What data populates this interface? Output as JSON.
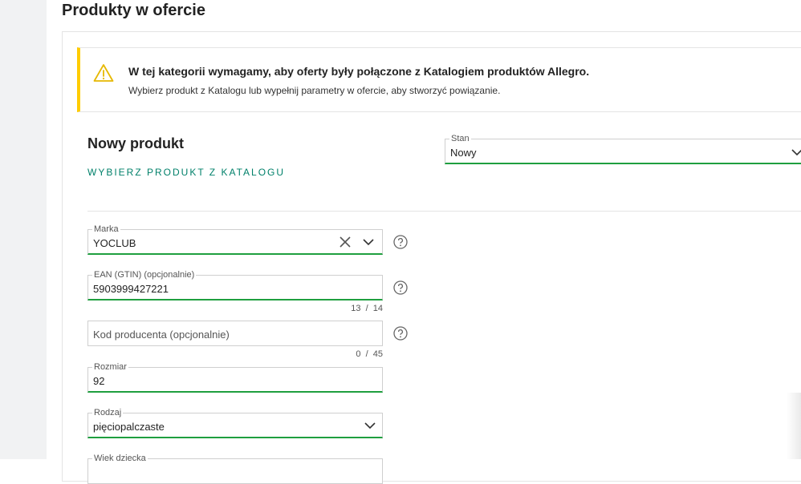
{
  "page": {
    "title": "Produkty w ofercie"
  },
  "alert": {
    "title": "W tej kategorii wymagamy, aby oferty były połączone z Katalogiem produktów Allegro.",
    "text": "Wybierz produkt z Katalogu lub wypełnij parametry w ofercie, aby stworzyć powiązanie.",
    "icon": "warning-icon",
    "accent": "#ffcc00"
  },
  "product": {
    "heading": "Nowy produkt",
    "catalog_link": "WYBIERZ PRODUKT Z KATALOGU"
  },
  "stan": {
    "label": "Stan",
    "value": "Nowy"
  },
  "fields": {
    "marka": {
      "label": "Marka",
      "value": "YOCLUB"
    },
    "ean": {
      "label": "EAN (GTIN) (opcjonalnie)",
      "value": "5903999427221",
      "counter": "13  /  14"
    },
    "kod": {
      "placeholder": "Kod producenta (opcjonalnie)",
      "counter": "0  /  45"
    },
    "rozmiar": {
      "label": "Rozmiar",
      "value": "92"
    },
    "rodzaj": {
      "label": "Rodzaj",
      "value": "pięciopalczaste"
    },
    "wiek": {
      "label": "Wiek dziecka"
    }
  },
  "colors": {
    "valid_border": "#1f9f3f",
    "link": "#00806a"
  }
}
